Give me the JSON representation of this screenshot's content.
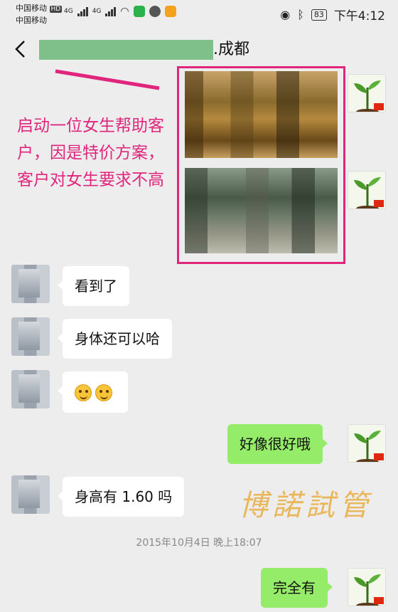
{
  "status_bar": {
    "carrier_1": "中国移动",
    "carrier_badge": "HD",
    "carrier_2": "中国移动",
    "network_1": "4G",
    "network_2": "4G",
    "battery": "83",
    "time": "下午4:12"
  },
  "header": {
    "title_suffix": ".成都"
  },
  "annotation": {
    "text": "启动一位女生帮助客户，因是特价方案，客户对女生要求不高",
    "color": "#e0257d"
  },
  "messages": [
    {
      "side": "in",
      "text": "看到了"
    },
    {
      "side": "in",
      "text": "身体还可以哈"
    },
    {
      "side": "in",
      "emojis": [
        "smile-emoji",
        "smile-emoji"
      ]
    },
    {
      "side": "out",
      "text": "好像很好哦"
    },
    {
      "side": "in",
      "text": "身高有 1.60 吗"
    },
    {
      "side": "out",
      "text": "完全有"
    }
  ],
  "timestamp": "2015年10月4日 晚上18:07",
  "watermark": "博諾試管",
  "colors": {
    "background": "#ededed",
    "bubble_out": "#95ec69",
    "bubble_in": "#ffffff",
    "highlight": "#e0257d"
  }
}
